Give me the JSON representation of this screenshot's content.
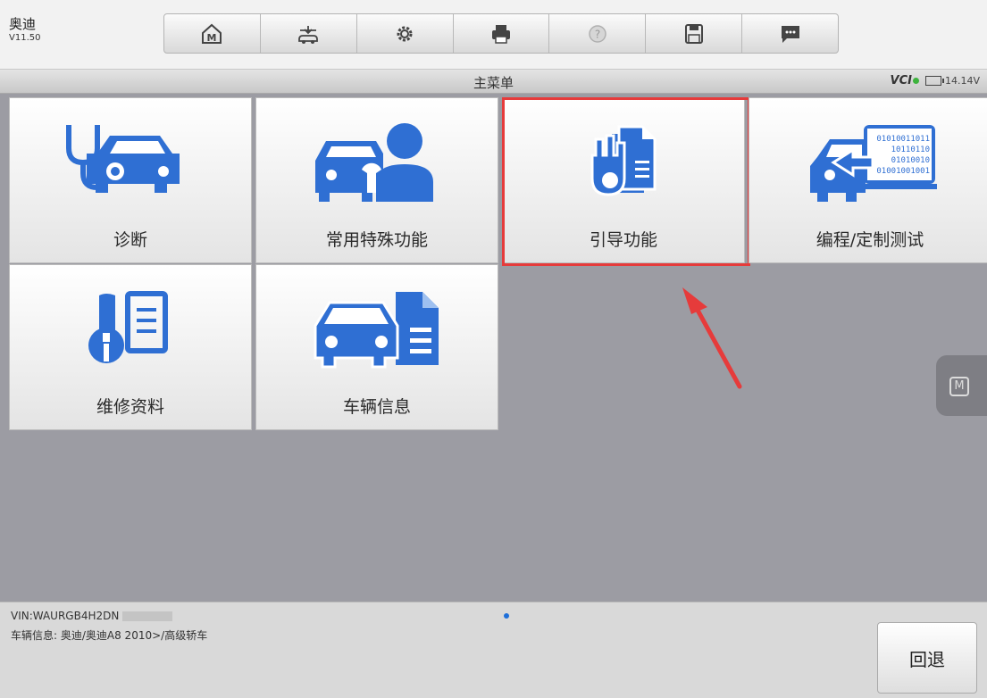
{
  "header": {
    "brand": "奥迪",
    "version": "V11.50",
    "toolbar_icons": [
      "home-icon",
      "vehicle-swap-icon",
      "settings-icon",
      "print-icon",
      "help-icon",
      "save-icon",
      "message-icon"
    ]
  },
  "titlebar": {
    "title": "主菜单",
    "vci": "VCI",
    "voltage": "14.14V"
  },
  "tiles": [
    {
      "label": "诊断",
      "icon": "diagnosis-icon"
    },
    {
      "label": "常用特殊功能",
      "icon": "special-functions-icon"
    },
    {
      "label": "引导功能",
      "icon": "guided-functions-icon"
    },
    {
      "label": "编程/定制测试",
      "icon": "programming-icon",
      "code_lines": [
        "01010011011",
        "10110110",
        "01010010",
        "01001001001"
      ]
    },
    {
      "label": "维修资料",
      "icon": "repair-info-icon"
    },
    {
      "label": "车辆信息",
      "icon": "vehicle-info-icon"
    }
  ],
  "side_button": {
    "label": "M"
  },
  "bottom": {
    "vin": "VIN:WAURGB4H2DN",
    "vehicle_info": "车辆信息: 奥迪/奥迪A8 2010>/高级轿车",
    "back_label": "回退"
  },
  "colors": {
    "accent": "#2f6fd3",
    "highlight": "#e63b3b",
    "background": "#9c9ca3"
  }
}
